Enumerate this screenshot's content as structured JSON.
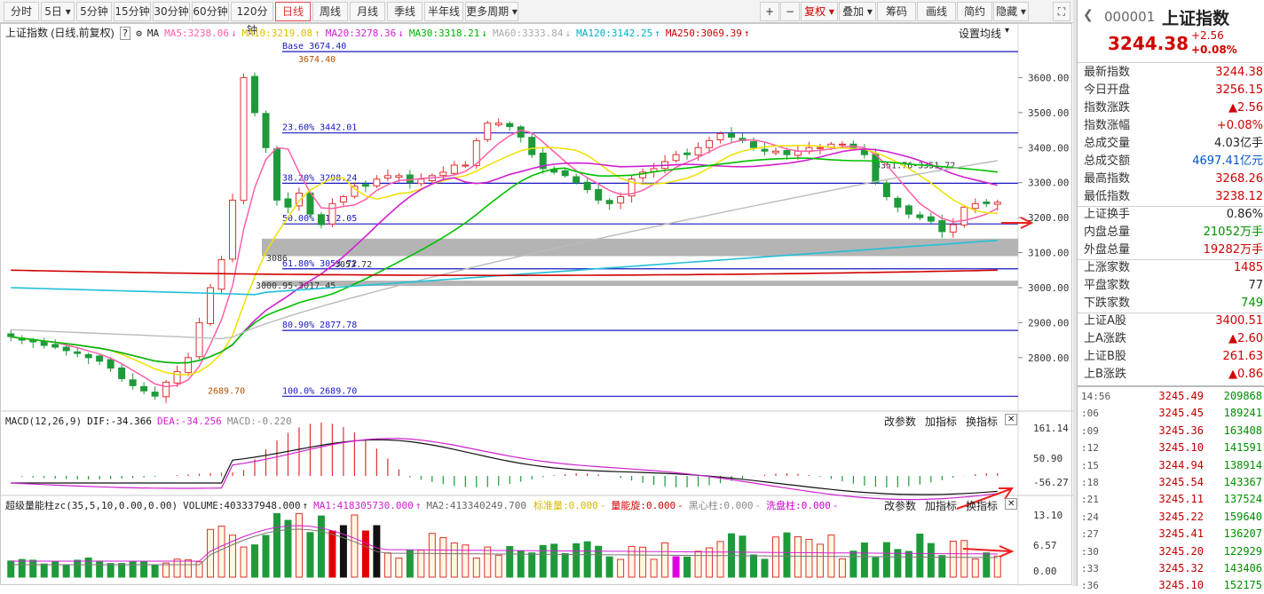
{
  "toolbar": {
    "periods": [
      "分时",
      "5日",
      "5分钟",
      "15分钟",
      "30分钟",
      "60分钟",
      "120分钟",
      "日线",
      "周线",
      "月线",
      "季线",
      "半年线",
      "更多周期"
    ],
    "active_period": "日线",
    "right_buttons": [
      "+",
      "−",
      "复权",
      "叠加",
      "筹码",
      "画线",
      "简约",
      "隐藏"
    ],
    "fuquan_label": "复权",
    "dropdown_arrow": "▾"
  },
  "main_panel": {
    "title": "上证指数 (日线,前复权)",
    "help": "?",
    "ma_label": "MA",
    "ma": [
      {
        "text": "MA5:3238.06",
        "color": "#ff5fa8",
        "arrow": "↓"
      },
      {
        "text": "MA10:3219.08",
        "color": "#e0c000",
        "arrow": "↑"
      },
      {
        "text": "MA20:3278.36",
        "color": "#d020d0",
        "arrow": "↓"
      },
      {
        "text": "MA30:3318.21",
        "color": "#00b000",
        "arrow": "↓"
      },
      {
        "text": "MA60:3333.84",
        "color": "#aaaaaa",
        "arrow": "↓"
      },
      {
        "text": "MA120:3142.25",
        "color": "#00b0c8",
        "arrow": "↑"
      },
      {
        "text": "MA250:3069.39",
        "color": "#d00000",
        "arrow": "↑"
      }
    ],
    "settings": "设置均线",
    "y_ticks": [
      "3600.00",
      "3500.00",
      "3400.00",
      "3300.00",
      "3200.00",
      "3100.00",
      "3000.00",
      "2900.00",
      "2800.00"
    ],
    "fib_labels": [
      "Base  3674.40",
      "23.60% 3442.01",
      "38.20% 3298.24",
      "50.00% 3182.05",
      "61.80% 3053.72",
      "80.90% 2877.78",
      "100.0% 2689.70"
    ],
    "annotations": [
      "3674.40",
      "2689.70",
      "3351.76-3351.72",
      "3000.95-3017.45",
      "3086",
      "3053.72"
    ]
  },
  "macd_panel": {
    "title": "MACD(12,26,9)",
    "dif": "DIF:-34.366",
    "dea": "DEA:-34.256",
    "macd": "MACD:-0.220",
    "buttons": [
      "改参数",
      "加指标",
      "换指标"
    ],
    "close": "✕",
    "y_ticks": [
      "161.14",
      "50.90",
      "-56.27"
    ]
  },
  "volume_panel": {
    "title": "超级量能柱zc(35,5,10,0.00,0.00)",
    "items": [
      {
        "text": "VOLUME:403337948.000",
        "color": "#222222",
        "arrow": "↑"
      },
      {
        "text": "MA1:418305730.000",
        "color": "#d020d0",
        "arrow": "↑"
      },
      {
        "text": "MA2:413340249.700",
        "color": "#666666",
        "arrow": ""
      },
      {
        "text": "标准量:0.000",
        "color": "#d8b800",
        "arrow": "-"
      },
      {
        "text": "量能旋:0.000",
        "color": "#d00000",
        "arrow": "-"
      },
      {
        "text": "黑心柱:0.000",
        "color": "#888888",
        "arrow": "-"
      },
      {
        "text": "洗盘柱:0.000",
        "color": "#d000d0",
        "arrow": "-"
      }
    ],
    "buttons": [
      "改参数",
      "加指标",
      "换指标"
    ],
    "close": "✕",
    "y_ticks": [
      "13.10",
      "6.57",
      "0.00"
    ]
  },
  "sidebar": {
    "code": "000001",
    "name": "上证指数",
    "price": "3244.38",
    "change": "+2.56",
    "change_pct": "+0.08%",
    "quotes": [
      {
        "label": "最新指数",
        "value": "3244.38",
        "color": "#d00000"
      },
      {
        "label": "今日开盘",
        "value": "3256.15",
        "color": "#d00000"
      },
      {
        "label": "指数涨跌",
        "value": "▲2.56",
        "color": "#d00000"
      },
      {
        "label": "指数涨幅",
        "value": "+0.08%",
        "color": "#d00000"
      },
      {
        "label": "总成交量",
        "value": "4.03亿手",
        "color": "#222222"
      },
      {
        "label": "总成交额",
        "value": "4697.41亿元",
        "color": "#0055cc"
      },
      {
        "label": "最高指数",
        "value": "3268.26",
        "color": "#d00000"
      },
      {
        "label": "最低指数",
        "value": "3238.12",
        "color": "#d00000"
      },
      {
        "label": "上证换手",
        "value": "0.86%",
        "color": "#222222"
      },
      {
        "label": "内盘总量",
        "value": "21052万手",
        "color": "#009000"
      },
      {
        "label": "外盘总量",
        "value": "19282万手",
        "color": "#d00000"
      },
      {
        "label": "上涨家数",
        "value": "1485",
        "color": "#d00000"
      },
      {
        "label": "平盘家数",
        "value": "77",
        "color": "#222222"
      },
      {
        "label": "下跌家数",
        "value": "749",
        "color": "#009000"
      },
      {
        "label": "上证A股",
        "value": "3400.51",
        "color": "#d00000"
      },
      {
        "label": "上A涨跌",
        "value": "▲2.60",
        "color": "#d00000"
      },
      {
        "label": "上证B股",
        "value": "261.63",
        "color": "#d00000"
      },
      {
        "label": "上B涨跌",
        "value": "▲0.86",
        "color": "#d00000"
      }
    ],
    "ticks": [
      {
        "time": "14:56",
        "price": "3245.49",
        "vol": "209868"
      },
      {
        "time": ":06",
        "price": "3245.45",
        "vol": "189241"
      },
      {
        "time": ":09",
        "price": "3245.36",
        "vol": "163408"
      },
      {
        "time": ":12",
        "price": "3245.10",
        "vol": "141591"
      },
      {
        "time": ":15",
        "price": "3244.94",
        "vol": "138914"
      },
      {
        "time": ":18",
        "price": "3245.54",
        "vol": "143367"
      },
      {
        "time": ":21",
        "price": "3245.11",
        "vol": "137524"
      },
      {
        "time": ":24",
        "price": "3245.22",
        "vol": "159640"
      },
      {
        "time": ":27",
        "price": "3245.41",
        "vol": "136207"
      },
      {
        "time": ":30",
        "price": "3245.20",
        "vol": "122929"
      },
      {
        "time": ":33",
        "price": "3245.32",
        "vol": "143406"
      },
      {
        "time": ":36",
        "price": "3245.10",
        "vol": "152175"
      }
    ]
  },
  "chart_data": {
    "type": "candlestick",
    "y_range": [
      2660,
      3700
    ],
    "fib_levels": [
      {
        "label": "Base",
        "value": 3674.4
      },
      {
        "label": "23.60%",
        "value": 3442.01
      },
      {
        "label": "38.20%",
        "value": 3298.24
      },
      {
        "label": "50.00%",
        "value": 3182.05
      },
      {
        "label": "61.80%",
        "value": 3053.72
      },
      {
        "label": "80.90%",
        "value": 2877.78
      },
      {
        "label": "100.0%",
        "value": 2689.7
      }
    ],
    "support_bands": [
      [
        3090,
        3140
      ],
      [
        3005,
        3020
      ]
    ],
    "close_path": [
      2860,
      2850,
      2845,
      2835,
      2830,
      2820,
      2812,
      2800,
      2790,
      2770,
      2740,
      2720,
      2705,
      2690,
      2730,
      2760,
      2800,
      2900,
      3000,
      3080,
      3250,
      3600,
      3500,
      3400,
      3250,
      3230,
      3270,
      3210,
      3180,
      3240,
      3260,
      3290,
      3290,
      3310,
      3320,
      3320,
      3300,
      3310,
      3320,
      3330,
      3350,
      3350,
      3420,
      3470,
      3470,
      3460,
      3430,
      3380,
      3340,
      3330,
      3320,
      3300,
      3280,
      3250,
      3240,
      3260,
      3310,
      3330,
      3340,
      3360,
      3380,
      3380,
      3400,
      3420,
      3440,
      3430,
      3420,
      3400,
      3390,
      3390,
      3380,
      3390,
      3400,
      3400,
      3410,
      3410,
      3400,
      3380,
      3300,
      3260,
      3230,
      3210,
      3200,
      3190,
      3160,
      3180,
      3230,
      3240,
      3240,
      3244
    ]
  }
}
